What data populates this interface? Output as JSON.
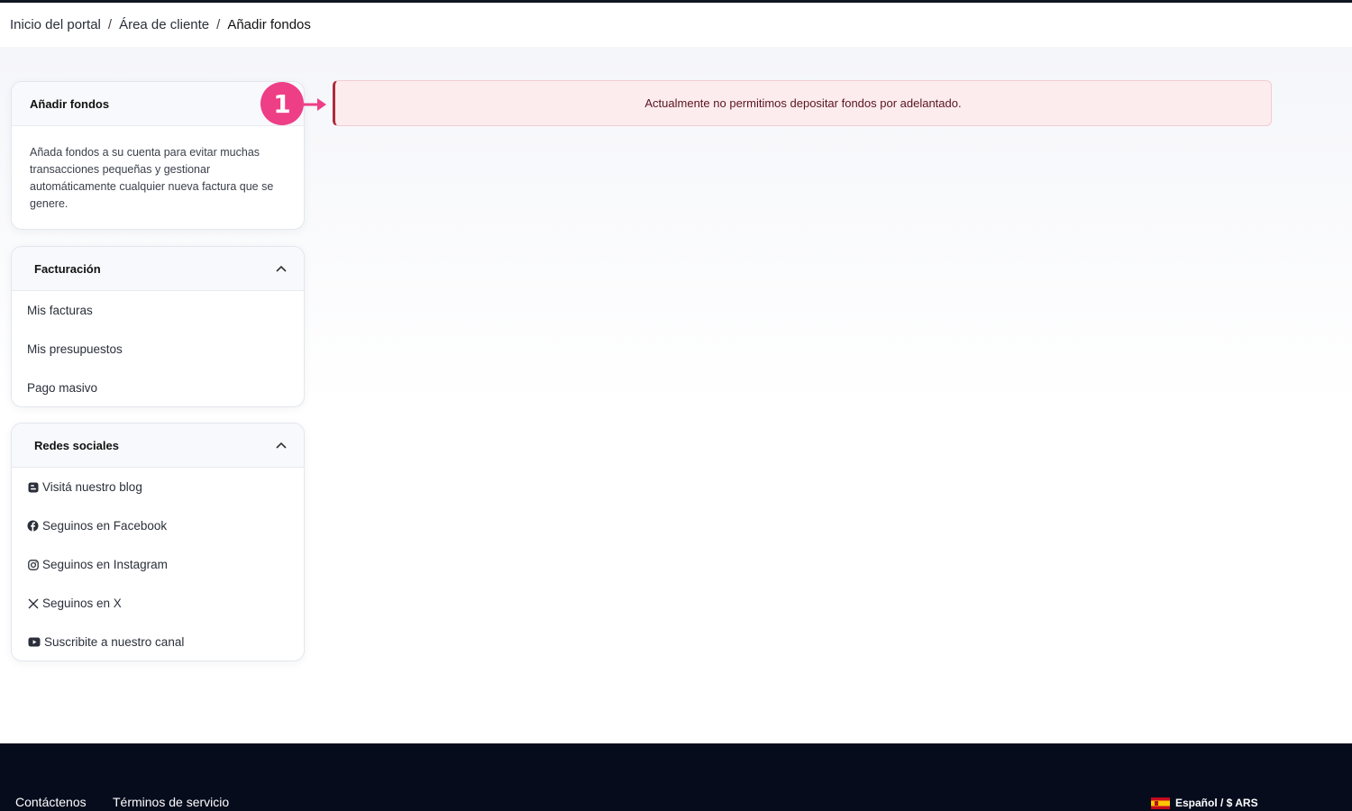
{
  "breadcrumb": {
    "items": [
      "Inicio del portal",
      "Área de cliente",
      "Añadir fondos"
    ],
    "separator": "/"
  },
  "add_funds_card": {
    "title": "Añadir fondos",
    "description": "Añada fondos a su cuenta para evitar muchas transacciones pequeñas y gestionar automáticamente cualquier nueva factura que se genere."
  },
  "billing_card": {
    "title": "Facturación",
    "items": [
      {
        "label": "Mis facturas"
      },
      {
        "label": "Mis presupuestos"
      },
      {
        "label": "Pago masivo"
      }
    ]
  },
  "social_card": {
    "title": "Redes sociales",
    "items": [
      {
        "label": "Visitá nuestro blog",
        "icon": "blogger-icon"
      },
      {
        "label": "Seguinos en Facebook",
        "icon": "facebook-icon"
      },
      {
        "label": "Seguinos en Instagram",
        "icon": "instagram-icon"
      },
      {
        "label": "Seguinos en X",
        "icon": "x-icon"
      },
      {
        "label": "Suscribite a nuestro canal",
        "icon": "youtube-icon"
      }
    ]
  },
  "alert": {
    "message": "Actualmente no permitimos depositar fondos por adelantado."
  },
  "annotation": {
    "number": "1",
    "color": "#ee3e86"
  },
  "footer": {
    "links": [
      "Contáctenos",
      "Términos de servicio"
    ],
    "language": "Español / $ ARS"
  },
  "colors": {
    "alert_background": "#fcecee",
    "alert_border": "#b02a3c",
    "footer_background": "#070c1d"
  }
}
